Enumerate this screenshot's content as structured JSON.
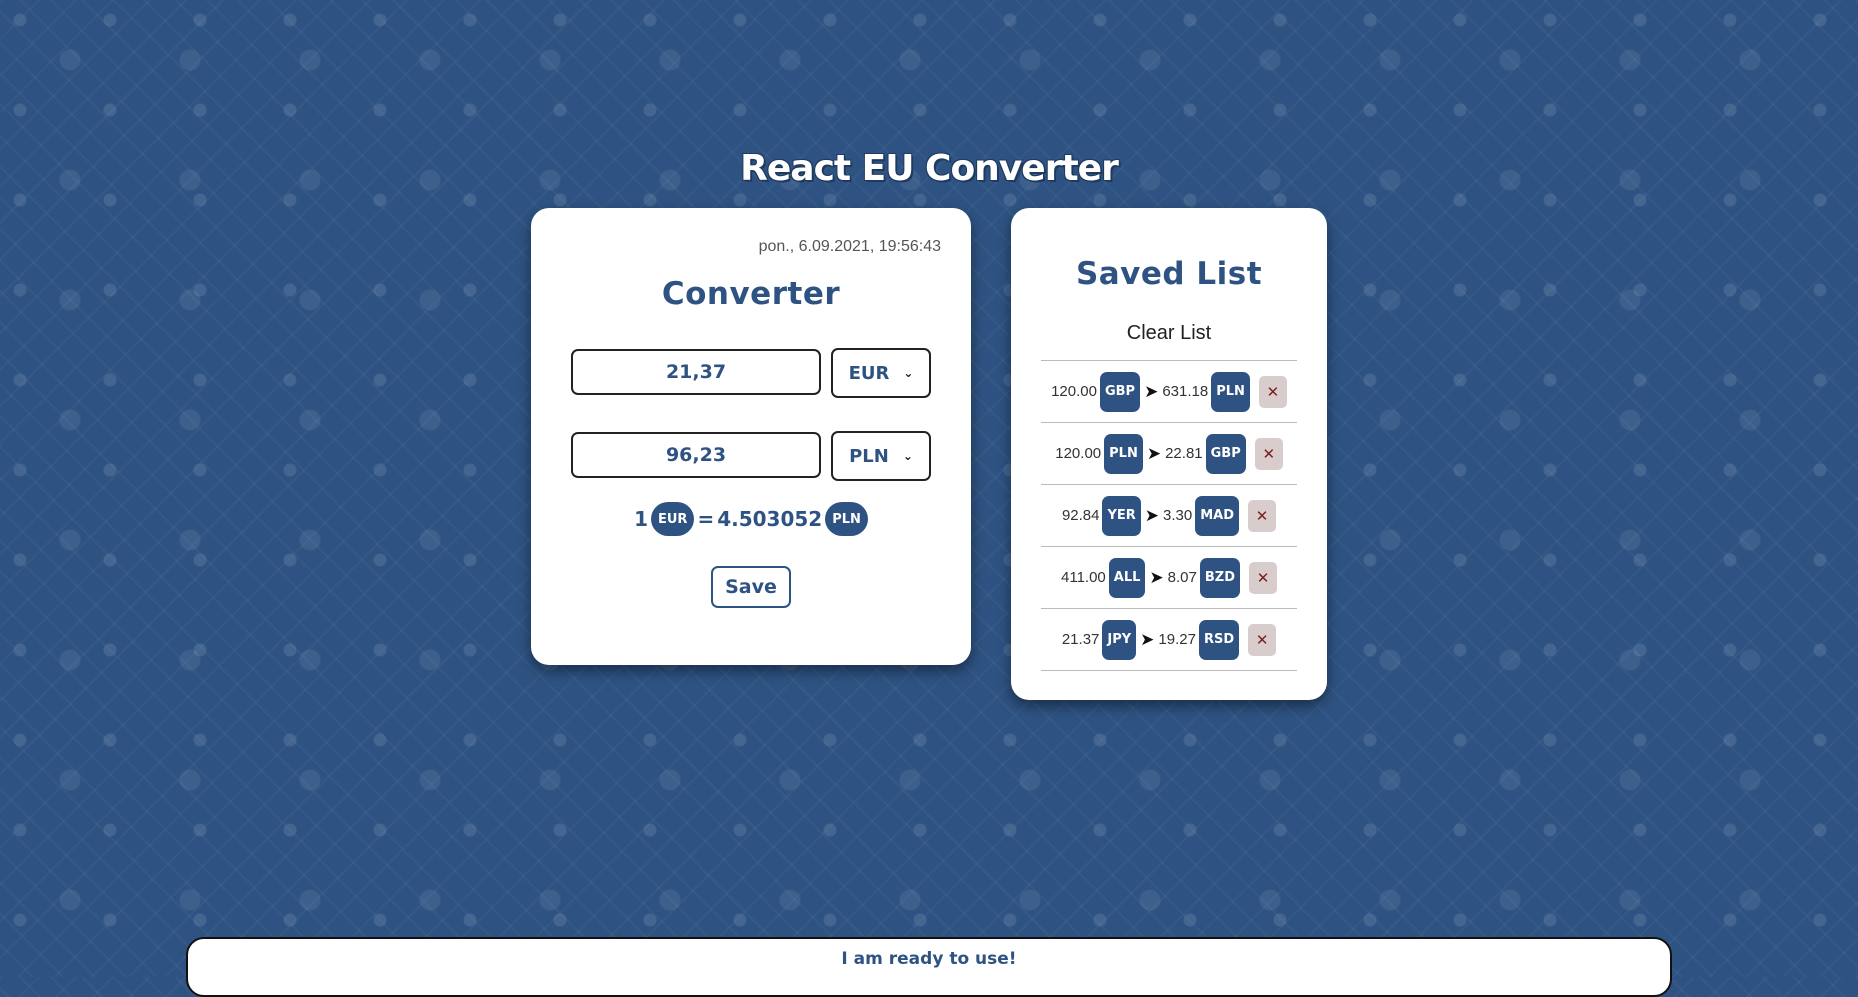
{
  "app": {
    "title": "React EU Converter"
  },
  "converter": {
    "timestamp": "pon., 6.09.2021, 19:56:43",
    "heading": "Converter",
    "from_amount": "21,37",
    "from_currency": "EUR",
    "to_amount": "96,23",
    "to_currency": "PLN",
    "rate": {
      "base_amount": "1",
      "base_currency": "EUR",
      "equals": "=",
      "value": "4.503052",
      "quote_currency": "PLN"
    },
    "save_label": "Save"
  },
  "saved": {
    "heading": "Saved List",
    "clear_label": "Clear List",
    "arrow": "➤",
    "delete_label": "✕",
    "items": [
      {
        "from_amount": "120.00",
        "from_currency": "GBP",
        "to_amount": "631.18",
        "to_currency": "PLN"
      },
      {
        "from_amount": "120.00",
        "from_currency": "PLN",
        "to_amount": "22.81",
        "to_currency": "GBP"
      },
      {
        "from_amount": "92.84",
        "from_currency": "YER",
        "to_amount": "3.30",
        "to_currency": "MAD"
      },
      {
        "from_amount": "411.00",
        "from_currency": "ALL",
        "to_amount": "8.07",
        "to_currency": "BZD"
      },
      {
        "from_amount": "21.37",
        "from_currency": "JPY",
        "to_amount": "19.27",
        "to_currency": "RSD"
      }
    ]
  },
  "footer": {
    "message": "I am ready to use!"
  },
  "colors": {
    "background": "#2e5383",
    "accent": "#2e5383",
    "card": "#ffffff",
    "delete_bg": "#d9cccc"
  }
}
